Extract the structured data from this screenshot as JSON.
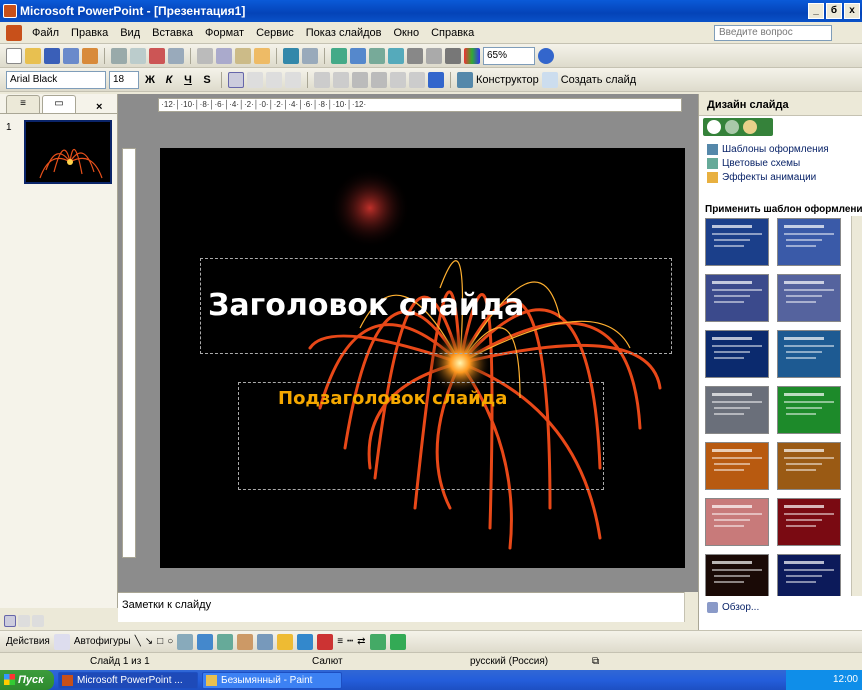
{
  "window": {
    "title": "Microsoft PowerPoint - [Презентация1]",
    "buttons": [
      "_",
      "б",
      "x"
    ]
  },
  "menu": {
    "items": [
      "Файл",
      "Правка",
      "Вид",
      "Вставка",
      "Формат",
      "Сервис",
      "Показ слайдов",
      "Окно",
      "Справка"
    ],
    "help_placeholder": "Введите вопрос"
  },
  "standard_toolbar": {
    "zoom": "65%"
  },
  "format_toolbar": {
    "font": "Arial Black",
    "size": "18",
    "bold": "Ж",
    "italic": "К",
    "underline": "Ч",
    "shadow": "S",
    "design_label": "Конструктор",
    "new_slide_label": "Создать слайд"
  },
  "left_panel": {
    "slide_number": "1"
  },
  "slide": {
    "title": "Заголовок слайда",
    "subtitle": "Подзаголовок слайда"
  },
  "notes": {
    "placeholder": "Заметки к слайду"
  },
  "task_pane": {
    "title": "Дизайн слайда",
    "links": [
      "Шаблоны оформления",
      "Цветовые схемы",
      "Эффекты анимации"
    ],
    "apply_label": "Применить шаблон оформления",
    "browse": "Обзор...",
    "template_colors": [
      "#1b3f8a",
      "#3a5aa8",
      "#3b4a8c",
      "#55639e",
      "#0b2a6e",
      "#1d5a92",
      "#6a6f7a",
      "#1d8a2a",
      "#b85a10",
      "#9a5a14",
      "#c87a7a",
      "#7a0a12",
      "#1a0a06",
      "#0c1a5a"
    ]
  },
  "drawing_toolbar": {
    "actions": "Действия",
    "autoshapes": "Автофигуры"
  },
  "status_bar": {
    "slide": "Слайд 1 из 1",
    "design": "Салют",
    "language": "русский (Россия)"
  },
  "taskbar": {
    "start": "Пуск",
    "tasks": [
      "Microsoft PowerPoint ...",
      "Безымянный - Paint"
    ],
    "clock": "12:00"
  }
}
